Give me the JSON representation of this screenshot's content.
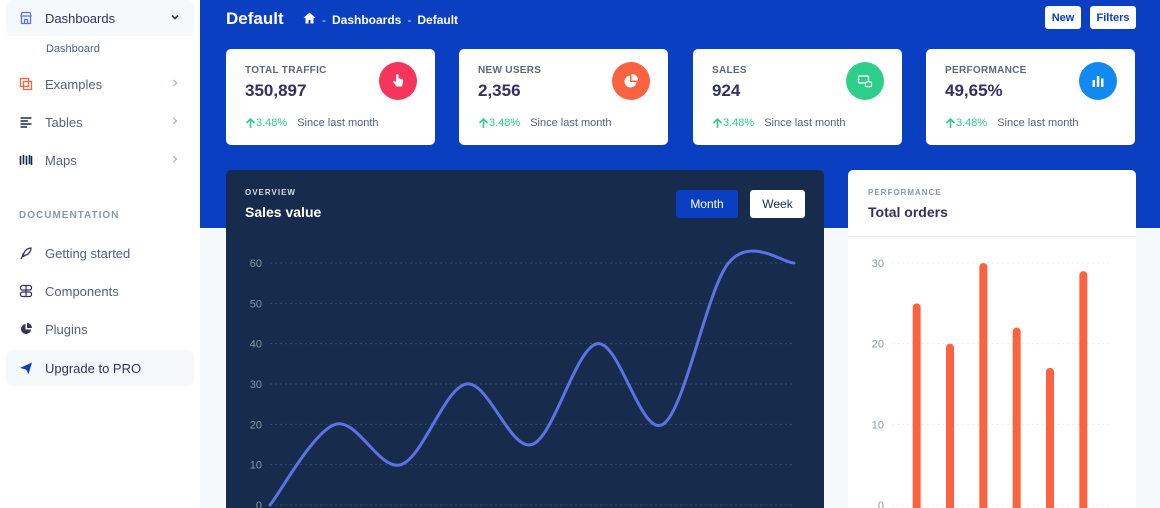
{
  "sidebar": {
    "items": [
      {
        "label": "Dashboards",
        "icon": "storefront-icon"
      },
      {
        "label": "Examples",
        "icon": "layers-icon"
      },
      {
        "label": "Tables",
        "icon": "list-icon"
      },
      {
        "label": "Maps",
        "icon": "map-icon"
      }
    ],
    "sub_item": "Dashboard",
    "doc_heading": "DOCUMENTATION",
    "doc_items": [
      {
        "label": "Getting started",
        "icon": "rocket-icon"
      },
      {
        "label": "Components",
        "icon": "components-icon"
      },
      {
        "label": "Plugins",
        "icon": "pie-icon"
      },
      {
        "label": "Upgrade to PRO",
        "icon": "send-icon"
      }
    ]
  },
  "header": {
    "title": "Default",
    "breadcrumb": [
      "Dashboards",
      "Default"
    ],
    "new_label": "New",
    "filters_label": "Filters"
  },
  "stats": [
    {
      "title": "TOTAL TRAFFIC",
      "value": "350,897",
      "change": "3.48%",
      "since": "Since last month",
      "icon": "pointer-icon",
      "color": "#f5365c"
    },
    {
      "title": "NEW USERS",
      "value": "2,356",
      "change": "3.48%",
      "since": "Since last month",
      "icon": "pie-chart-icon",
      "color": "#fb6340"
    },
    {
      "title": "SALES",
      "value": "924",
      "change": "3.48%",
      "since": "Since last month",
      "icon": "money-coins-icon",
      "color": "#2dce89"
    },
    {
      "title": "PERFORMANCE",
      "value": "49,65%",
      "change": "3.48%",
      "since": "Since last month",
      "icon": "bar-chart-icon",
      "color": "#11cdef"
    }
  ],
  "sales_panel": {
    "overline": "OVERVIEW",
    "title": "Sales value",
    "month_label": "Month",
    "week_label": "Week"
  },
  "orders_panel": {
    "overline": "PERFORMANCE",
    "title": "Total orders"
  },
  "colors": {
    "primary": "#0b3fc1",
    "dark": "#172b4d",
    "line": "#5e72e4",
    "bar": "#fb6340",
    "success": "#2dce89"
  },
  "chart_data": [
    {
      "type": "line",
      "x": [
        0,
        1,
        2,
        3,
        4,
        5,
        6,
        7,
        8
      ],
      "values": [
        0,
        20,
        10,
        30,
        15,
        40,
        20,
        60,
        60
      ],
      "y_ticks": [
        0,
        10,
        20,
        30,
        40,
        50,
        60
      ],
      "ylim": [
        0,
        60
      ],
      "grid": true
    },
    {
      "type": "bar",
      "values": [
        25,
        20,
        30,
        22,
        17,
        29
      ],
      "y_ticks": [
        0,
        10,
        20,
        30
      ],
      "ylim": [
        0,
        30
      ],
      "grid": true
    }
  ]
}
